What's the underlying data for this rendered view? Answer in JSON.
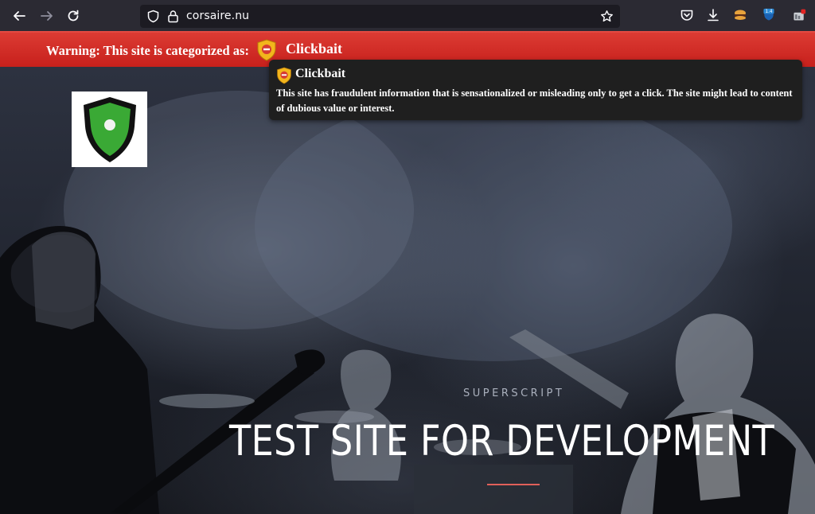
{
  "browser": {
    "url": "corsaire.nu",
    "icons": [
      "back-arrow-icon",
      "forward-arrow-icon",
      "reload-icon",
      "shield-icon",
      "lock-icon",
      "bookmark-star-icon",
      "pocket-icon",
      "download-icon",
      "extension-burger-icon",
      "extension-badge-icon",
      "extension-red-icon"
    ],
    "extension_badge": "1.4"
  },
  "warning": {
    "prefix": "Warning: This site is categorized as:",
    "category": "Clickbait"
  },
  "tooltip": {
    "title": "Clickbait",
    "description": "This site has fraudulent information that is sensationalized or misleading only to get a click. The site might lead to content of dubious value or interest."
  },
  "hero": {
    "superscript": "SUPERSCRIPT",
    "title": "TEST SITE FOR DEVELOPMENT"
  },
  "colors": {
    "warning_bar": "#d32f2a",
    "tooltip_bg": "#1f1f1f",
    "shield_green": "#3aa935",
    "shield_yellow": "#f2b51c",
    "accent_line": "#e0605a"
  }
}
